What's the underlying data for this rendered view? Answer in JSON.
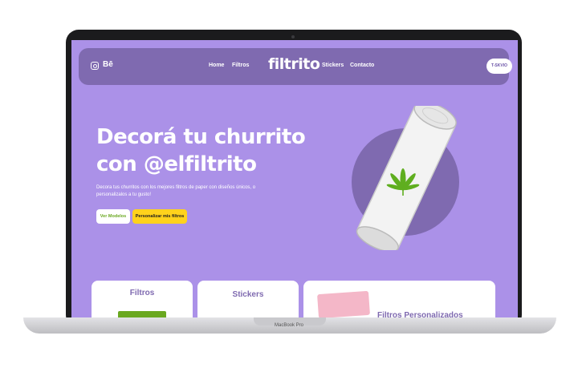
{
  "nav": {
    "behance_label": "Bē",
    "links": [
      "Home",
      "Filtros",
      "Stickers",
      "Contacto"
    ],
    "logo": "filtrito",
    "cta_label": "T-SKVIO"
  },
  "hero": {
    "title_line1": "Decorá tu churrito",
    "title_line2": "con @elfiltrito",
    "subtitle": "Decora tus churritos con los mejores filtros de paper con diseños únicos, o personalizalos a tu gusto!",
    "btn_models": "Ver Modelos",
    "btn_custom": "Personalizar mis filtros"
  },
  "cards": [
    "Filtros",
    "Stickers",
    "Filtros Personalizados"
  ],
  "device": {
    "model": "MacBook Pro"
  },
  "colors": {
    "bg": "#ab91e8",
    "nav": "#7f6ab0",
    "yellow": "#ffd21c",
    "green": "#6aa820"
  }
}
